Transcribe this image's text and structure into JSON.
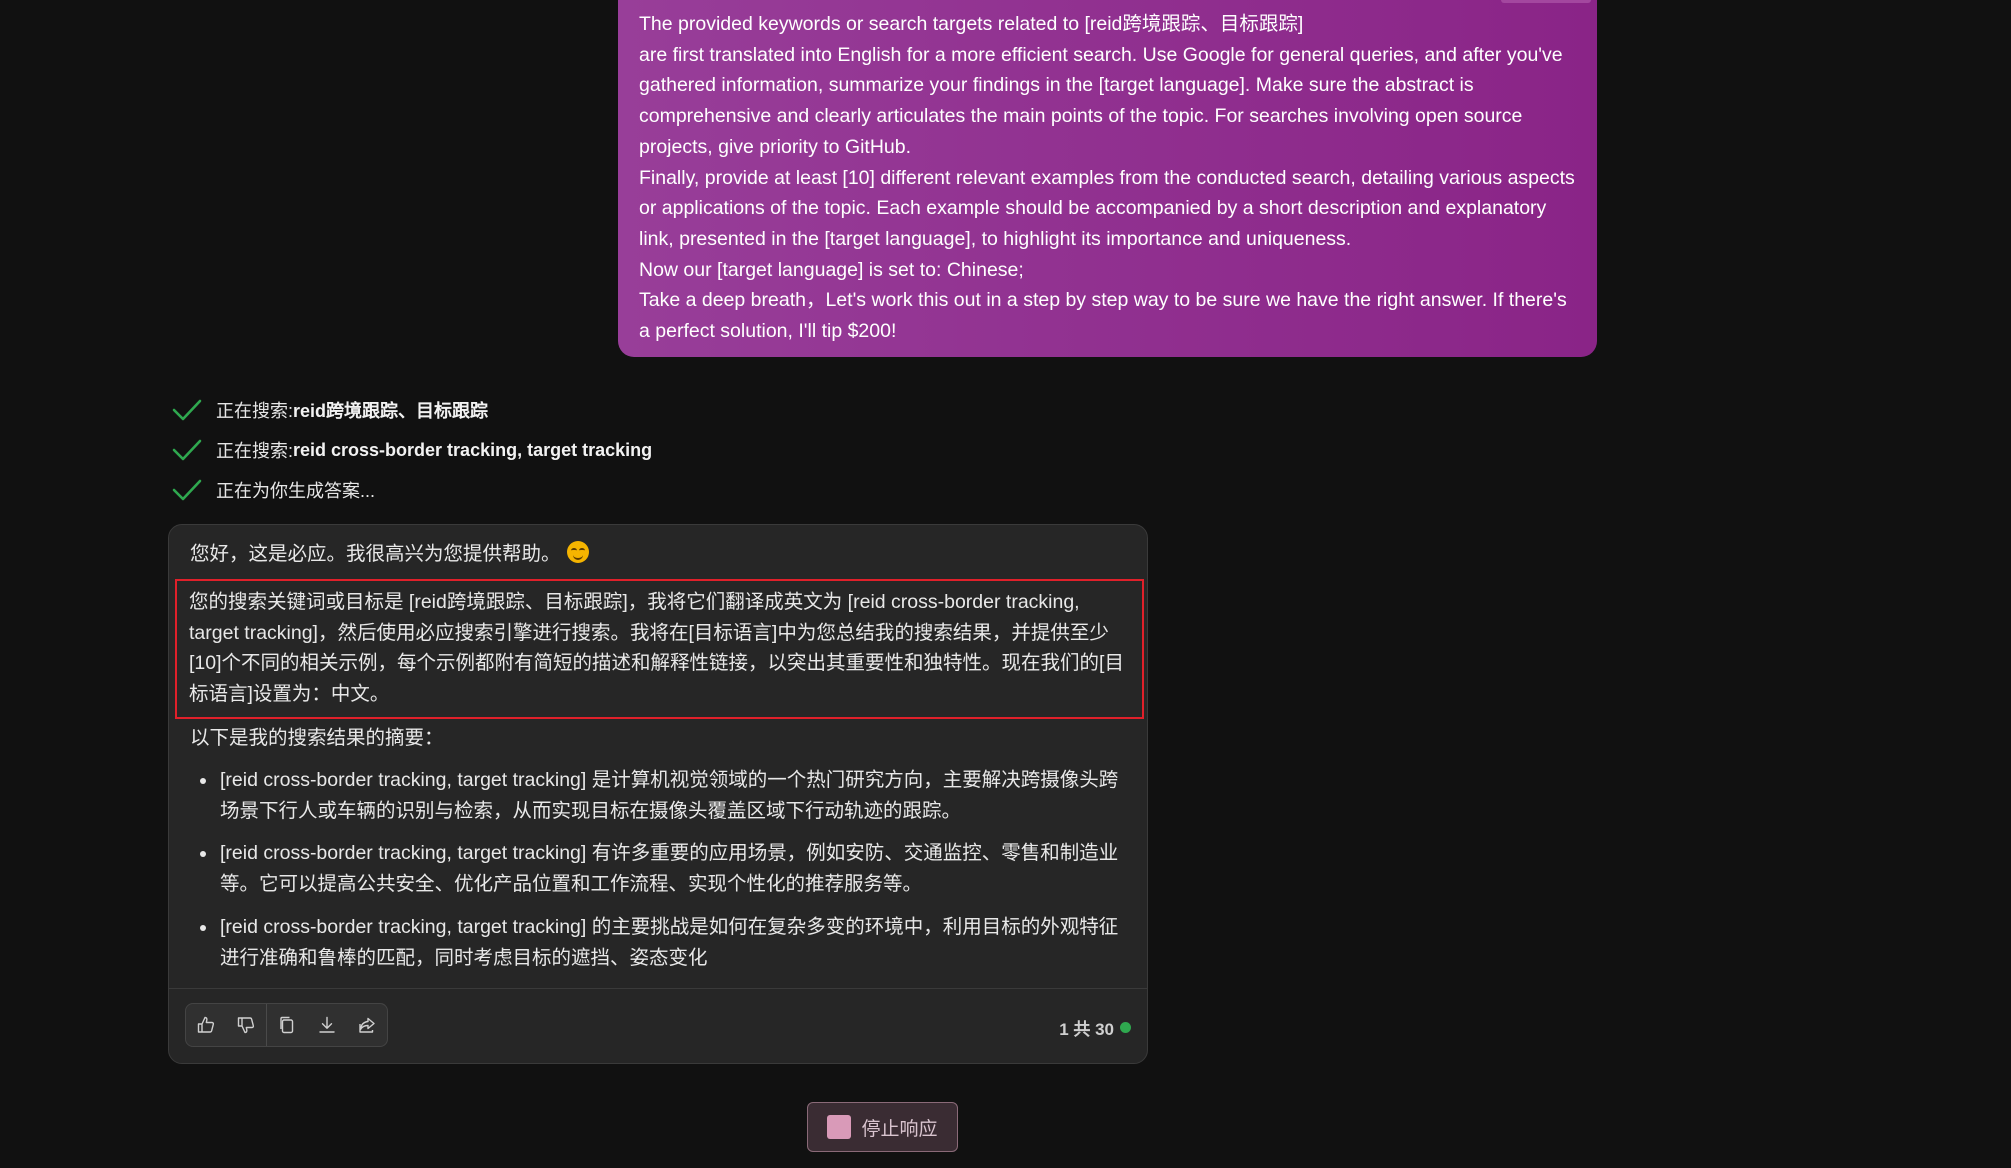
{
  "prompt": {
    "lines": [
      "The provided keywords or search targets related to  [reid跨境跟踪、目标跟踪]",
      "are first translated into English for a more efficient search.   Use Google for general queries, and after you've gathered information, summarize your findings in the [target language].   Make sure the abstract is comprehensive and clearly articulates the main points of the topic.   For searches involving open source projects, give priority to GitHub.",
      "Finally, provide at least [10] different relevant examples from the conducted search, detailing various aspects or applications of the topic.   Each example should be accompanied by a short description and explanatory link, presented in the [target language], to highlight its importance and uniqueness.",
      "Now our [target language] is set to: Chinese;",
      "Take a deep breath，Let's work this out in a step by step way to be sure we have the right answer.   If there's a perfect solution, I'll tip $200!"
    ]
  },
  "steps": [
    {
      "prefix": "正在搜索: ",
      "term": "reid跨境跟踪、目标跟踪"
    },
    {
      "prefix": "正在搜索: ",
      "term": "reid cross-border tracking, target tracking"
    },
    {
      "prefix": "正在为你生成答案...",
      "term": ""
    }
  ],
  "response": {
    "greeting": "您好，这是必应。我很高兴为您提供帮助。",
    "emoji": "smiling-face-icon",
    "highlighted_paragraph": "您的搜索关键词或目标是 [reid跨境跟踪、目标跟踪]，我将它们翻译成英文为 [reid cross-border tracking, target tracking]，然后使用必应搜索引擎进行搜索。我将在[目标语言]中为您总结我的搜索结果，并提供至少[10]个不同的相关示例，每个示例都附有简短的描述和解释性链接，以突出其重要性和独特性。现在我们的[目标语言]设置为：中文。",
    "summary_intro": "以下是我的搜索结果的摘要：",
    "bullets": [
      "[reid cross-border tracking, target tracking] 是计算机视觉领域的一个热门研究方向，主要解决跨摄像头跨场景下行人或车辆的识别与检索，从而实现目标在摄像头覆盖区域下行动轨迹的跟踪。",
      "[reid cross-border tracking, target tracking] 有许多重要的应用场景，例如安防、交通监控、零售和制造业等。它可以提高公共安全、优化产品位置和工作流程、实现个性化的推荐服务等。",
      "[reid cross-border tracking, target tracking] 的主要挑战是如何在复杂多变的环境中，利用目标的外观特征进行准确和鲁棒的匹配，同时考虑目标的遮挡、姿态变化"
    ],
    "actions": [
      "thumbs-up-icon",
      "thumbs-down-icon",
      "copy-icon",
      "download-icon",
      "share-icon"
    ],
    "counter": "1 共 30",
    "counter_dot_color": "#2fa84f"
  },
  "stop_button": {
    "label": "停止响应"
  },
  "colors": {
    "background": "#111111",
    "prompt_bubble": "#902f8f",
    "highlight_border": "#e0202a",
    "check": "#2fa84f"
  }
}
